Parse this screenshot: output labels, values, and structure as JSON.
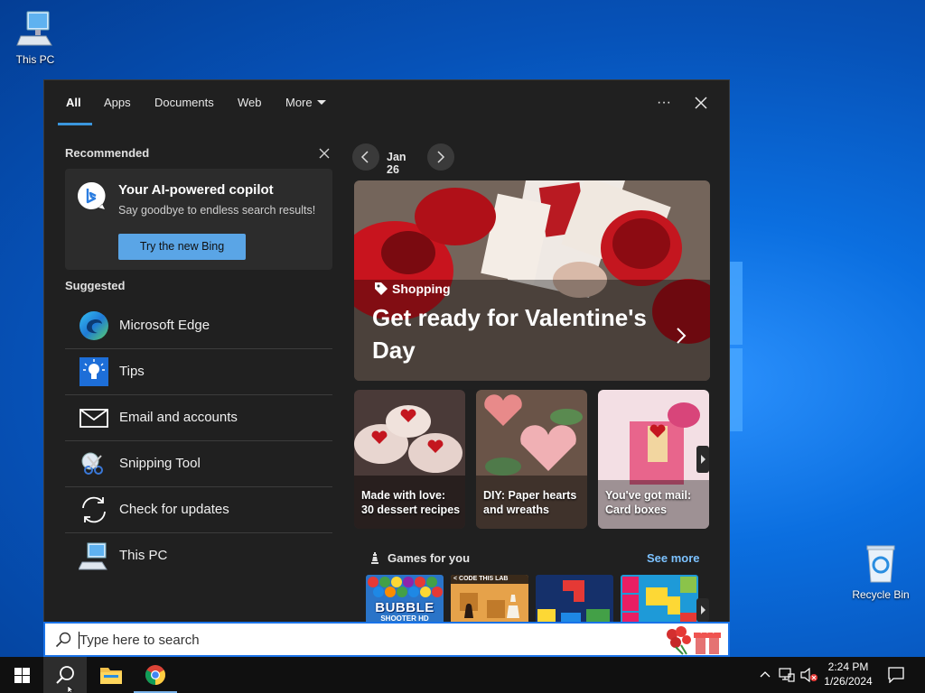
{
  "desktop": {
    "this_pc_label": "This PC",
    "recycle_bin_label": "Recycle Bin"
  },
  "tabs": [
    {
      "label": "All",
      "active": true
    },
    {
      "label": "Apps"
    },
    {
      "label": "Documents"
    },
    {
      "label": "Web"
    },
    {
      "label": "More"
    }
  ],
  "header": {
    "options_glyph": "···",
    "close_glyph": "✕"
  },
  "recommended": {
    "title": "Recommended",
    "card_title": "Your AI-powered copilot",
    "card_subtitle": "Say goodbye to endless search results!",
    "button_label": "Try the new Bing"
  },
  "suggested": {
    "title": "Suggested",
    "items": [
      {
        "label": "Microsoft Edge",
        "icon": "edge-icon"
      },
      {
        "label": "Tips",
        "icon": "tips-icon"
      },
      {
        "label": "Email and accounts",
        "icon": "mail-icon"
      },
      {
        "label": "Snipping Tool",
        "icon": "snipping-tool-icon"
      },
      {
        "label": "Check for updates",
        "icon": "refresh-icon"
      },
      {
        "label": "This PC",
        "icon": "computer-icon"
      }
    ]
  },
  "feed": {
    "date": "Jan 26",
    "hero": {
      "category": "Shopping",
      "title": "Get ready for Valentine's Day"
    },
    "cards": [
      {
        "caption_line1": "Made with love:",
        "caption_line2": "30 dessert recipes"
      },
      {
        "caption_line1": "DIY: Paper hearts",
        "caption_line2": "and wreaths"
      },
      {
        "caption_line1": "You've got mail:",
        "caption_line2": "Card boxes"
      }
    ],
    "games": {
      "title": "Games for you",
      "see_more": "See more",
      "tiles": [
        {
          "name": "Bubble Shooter",
          "line1": "BUBBLE",
          "line2": "SHOOTER HD"
        },
        {
          "name": "Code This Lab chess",
          "line1": "< CODE THIS LAB"
        },
        {
          "name": "Block puzzle"
        },
        {
          "name": "Color blocks"
        }
      ]
    }
  },
  "search": {
    "placeholder": "Type here to search"
  },
  "taskbar": {
    "time": "2:24 PM",
    "date": "1/26/2024"
  },
  "colors": {
    "accent": "#3a96dd",
    "panel_bg": "#202020",
    "button_blue": "#5aa5e6",
    "link_blue": "#7cc2ff"
  }
}
